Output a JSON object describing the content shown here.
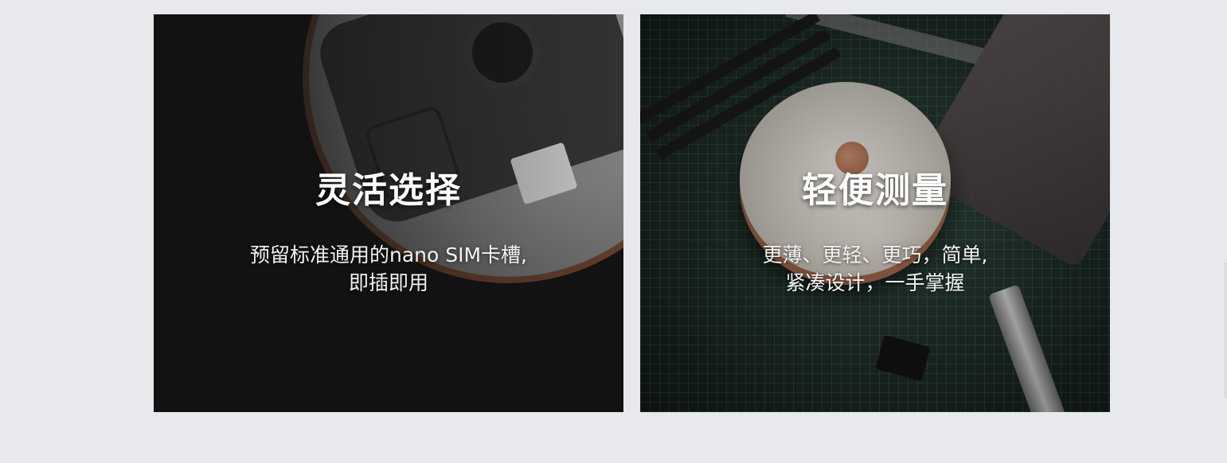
{
  "cards": [
    {
      "title": "灵活选择",
      "description_lines": [
        "预留标准通用的nano SIM卡槽,",
        "即插即用"
      ],
      "image": "receiver-bottom-sim-slot"
    },
    {
      "title": "轻便测量",
      "description_lines": [
        "更薄、更轻、更巧，简单,",
        "紧凑设计，一手掌握"
      ],
      "image": "receiver-on-cutting-mat"
    }
  ],
  "colors": {
    "page_background": "#e8e9ec",
    "left_card_background": "#121212",
    "right_card_background": "#1c2a25",
    "text": "#ffffff"
  }
}
